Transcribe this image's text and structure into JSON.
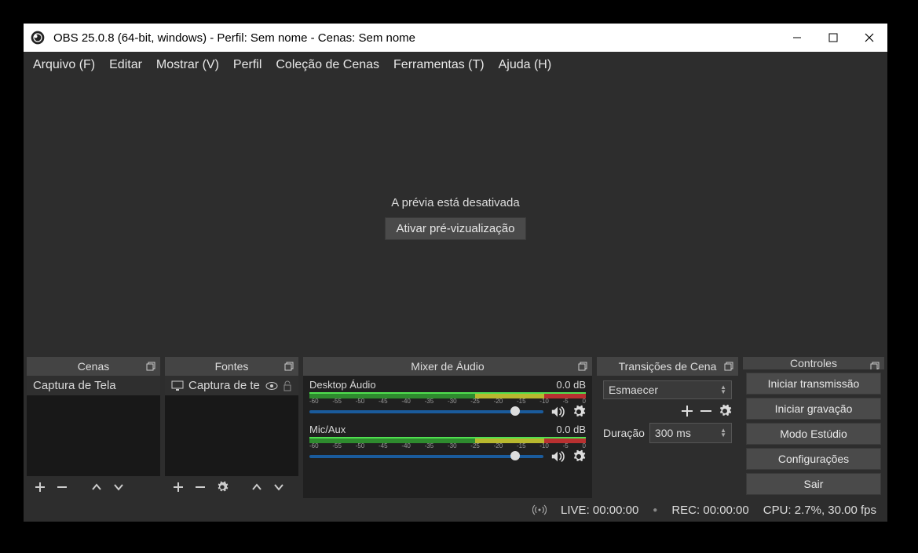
{
  "title": "OBS 25.0.8 (64-bit, windows) - Perfil: Sem nome - Cenas: Sem nome",
  "menu": [
    "Arquivo (F)",
    "Editar",
    "Mostrar (V)",
    "Perfil",
    "Coleção de Cenas",
    "Ferramentas (T)",
    "Ajuda (H)"
  ],
  "preview": {
    "disabled_text": "A prévia está desativada",
    "enable_button": "Ativar pré-vizualização"
  },
  "docks": {
    "scenes": {
      "title": "Cenas",
      "items": [
        "Captura de Tela"
      ]
    },
    "sources": {
      "title": "Fontes",
      "items": [
        "Captura de te"
      ]
    },
    "mixer": {
      "title": "Mixer de Áudio",
      "tracks": [
        {
          "name": "Desktop Áudio",
          "level": "0.0 dB",
          "ticks": [
            "-60",
            "-55",
            "-50",
            "-45",
            "-40",
            "-35",
            "-30",
            "-25",
            "-20",
            "-15",
            "-10",
            "-5",
            "0"
          ]
        },
        {
          "name": "Mic/Aux",
          "level": "0.0 dB",
          "ticks": [
            "-60",
            "-55",
            "-50",
            "-45",
            "-40",
            "-35",
            "-30",
            "-25",
            "-20",
            "-15",
            "-10",
            "-5",
            "0"
          ]
        }
      ]
    },
    "transitions": {
      "title": "Transições de Cena",
      "selected": "Esmaecer",
      "duration_label": "Duração",
      "duration_value": "300 ms"
    },
    "controls": {
      "title": "Controles",
      "buttons": [
        "Iniciar transmissão",
        "Iniciar gravação",
        "Modo Estúdio",
        "Configurações",
        "Sair"
      ]
    }
  },
  "status": {
    "live": "LIVE: 00:00:00",
    "rec": "REC: 00:00:00",
    "cpu": "CPU: 2.7%, 30.00 fps"
  }
}
